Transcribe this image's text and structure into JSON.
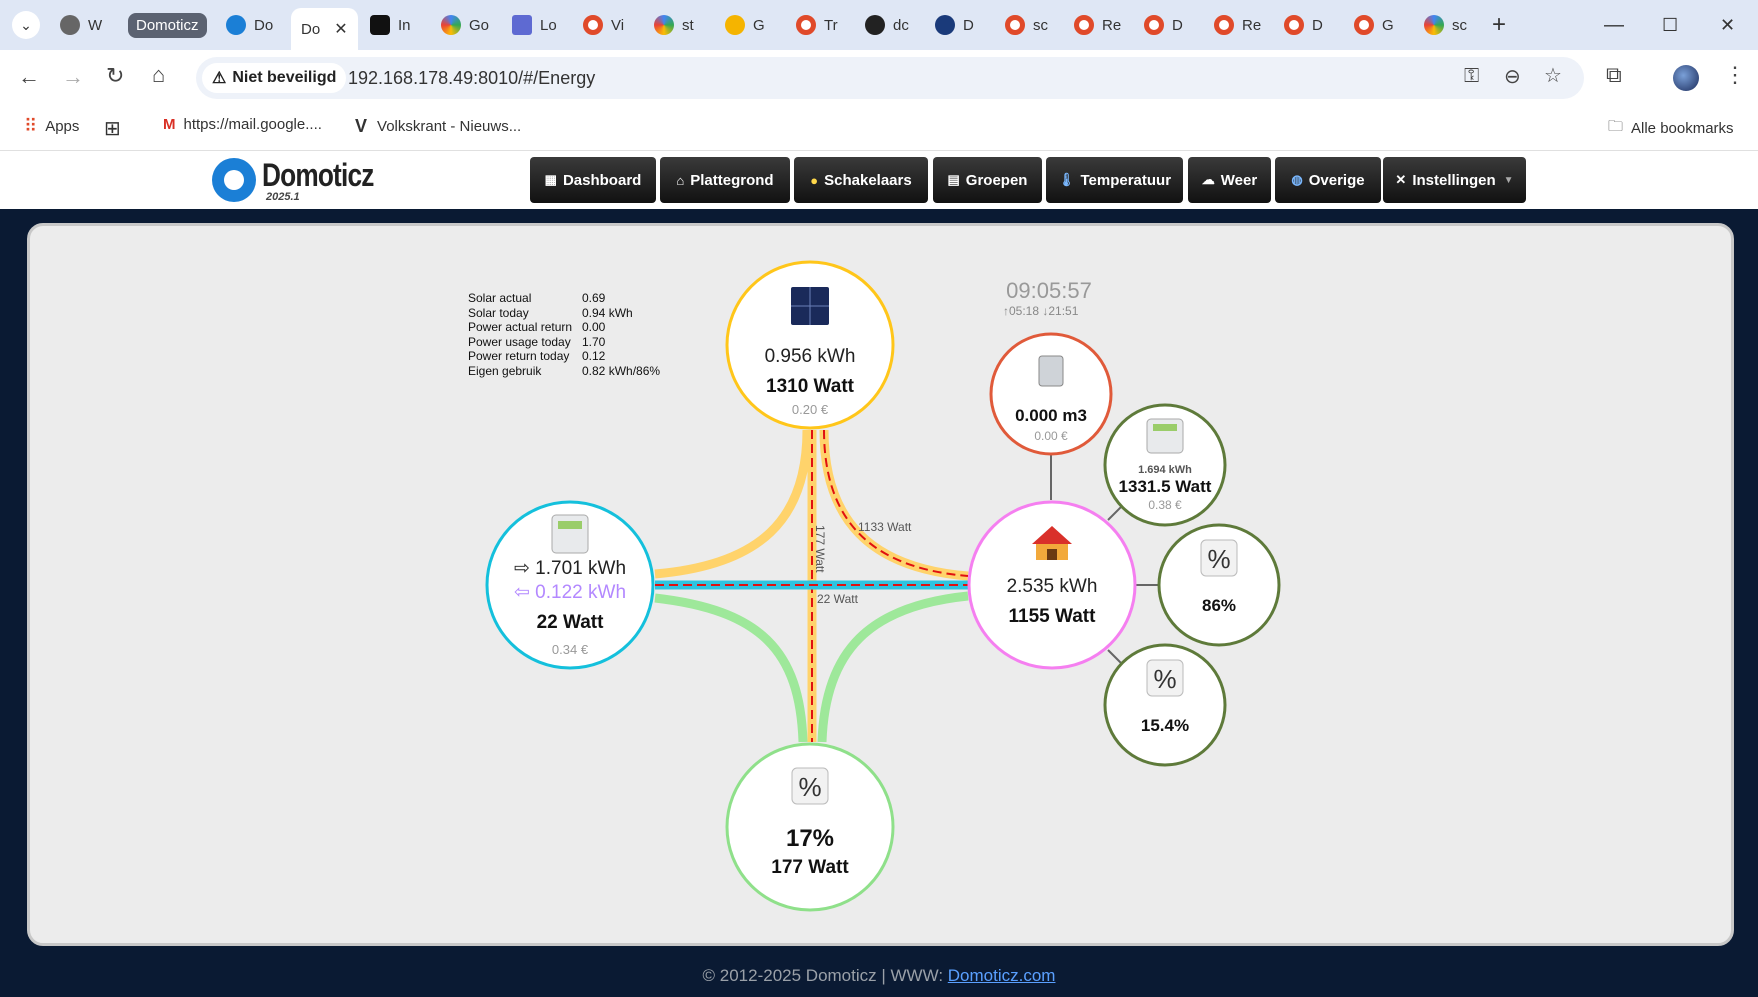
{
  "browser": {
    "tabs": [
      {
        "label": "W",
        "favicon": "chrome-icon"
      },
      {
        "label": "Domoticz",
        "favicon": "group-label"
      },
      {
        "label": "Do",
        "favicon": "domoticz-icon"
      },
      {
        "label": "Do",
        "favicon": "domoticz-icon",
        "active": true
      },
      {
        "label": "In",
        "favicon": "bolt-icon"
      },
      {
        "label": "Go",
        "favicon": "google-home-icon"
      },
      {
        "label": "Lo",
        "favicon": "linear-icon"
      },
      {
        "label": "Vi",
        "favicon": "domoticz-icon"
      },
      {
        "label": "st",
        "favicon": "google-icon"
      },
      {
        "label": "G",
        "favicon": "sun-icon"
      },
      {
        "label": "Tr",
        "favicon": "domoticz-icon"
      },
      {
        "label": "dc",
        "favicon": "github-icon"
      },
      {
        "label": "D",
        "favicon": "telegraaf-icon"
      },
      {
        "label": "sc",
        "favicon": "domoticz-icon"
      },
      {
        "label": "Re",
        "favicon": "domoticz-icon"
      },
      {
        "label": "D",
        "favicon": "domoticz-icon"
      },
      {
        "label": "Re",
        "favicon": "domoticz-icon"
      },
      {
        "label": "D",
        "favicon": "domoticz-icon"
      },
      {
        "label": "G",
        "favicon": "domoticz-icon"
      },
      {
        "label": "sc",
        "favicon": "google-icon"
      }
    ],
    "security_label": "Niet beveiligd",
    "url": "192.168.178.49:8010/#/Energy",
    "bookmarks": {
      "apps": "Apps",
      "mail": "https://mail.google....",
      "volkskrant": "Volkskrant - Nieuws...",
      "all": "Alle bookmarks"
    }
  },
  "app": {
    "logo": "Domoticz",
    "version": "2025.1",
    "nav": [
      {
        "label": "Dashboard",
        "icon": "dashboard-icon"
      },
      {
        "label": "Plattegrond",
        "icon": "house-icon"
      },
      {
        "label": "Schakelaars",
        "icon": "bulb-icon"
      },
      {
        "label": "Groepen",
        "icon": "clapper-icon"
      },
      {
        "label": "Temperatuur",
        "icon": "thermometer-icon"
      },
      {
        "label": "Weer",
        "icon": "cloud-icon"
      },
      {
        "label": "Overige",
        "icon": "globe-icon"
      },
      {
        "label": "Instellingen",
        "icon": "tools-icon",
        "dropdown": true
      }
    ]
  },
  "energy": {
    "stats": [
      {
        "key": "Solar actual",
        "value": " 0.69"
      },
      {
        "key": "Solar today",
        "value": "0.94 kWh"
      },
      {
        "key": "Power actual return",
        "value": "0.00"
      },
      {
        "key": "Power usage today",
        "value": " 1.70"
      },
      {
        "key": "Power return today",
        "value": " 0.12"
      },
      {
        "key": "Eigen gebruik",
        "value": "0.82 kWh/86%"
      }
    ],
    "clock": {
      "time": "09:05:57",
      "sun": "↑05:18 ↓21:51"
    },
    "solar": {
      "energy": "0.956 kWh",
      "power": "1310 Watt",
      "cost": "0.20 €",
      "icon": "solar-panel-icon"
    },
    "grid": {
      "import": "⇨ 1.701 kWh",
      "export": "⇦ 0.122 kWh",
      "power": "22 Watt",
      "cost": "0.34 €",
      "icon": "meter-icon"
    },
    "home": {
      "energy": "2.535 kWh",
      "power": "1155 Watt",
      "icon": "house-icon"
    },
    "battery": {
      "percent": "17%",
      "power": "177 Watt",
      "icon": "percent-icon"
    },
    "gas": {
      "volume": "0.000 m3",
      "cost": "0.00 €",
      "icon": "gas-meter-icon"
    },
    "submeter": {
      "energy": "1.694 kWh",
      "power": "1331.5 Watt",
      "cost": "0.38 €",
      "icon": "meter-icon"
    },
    "self_use": {
      "percent": "86%",
      "icon": "percent-icon"
    },
    "other_pct": {
      "percent": "15.4%",
      "icon": "percent-icon"
    },
    "flows": {
      "solar_home": "1133 Watt",
      "solar_battery": "177 Watt",
      "grid_home": "22 Watt"
    }
  },
  "footer": {
    "text": "© 2012-2025 Domoticz | WWW: ",
    "link": "Domoticz.com"
  }
}
